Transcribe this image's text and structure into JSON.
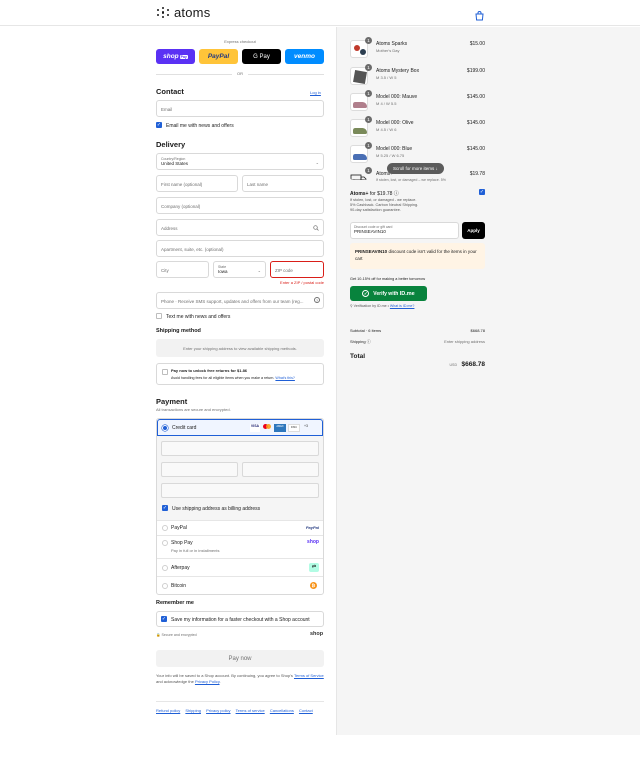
{
  "brand": {
    "name": "atoms"
  },
  "express": {
    "label": "Express checkout",
    "or": "OR",
    "shop_pay": "shop",
    "shop_pay_tag": "Pay",
    "paypal": "PayPal",
    "gpay": "G Pay",
    "venmo": "venmo",
    "colors": {
      "shop": "#5a31f4",
      "paypal": "#ffc439",
      "gpay": "#000000",
      "venmo": "#008cff"
    }
  },
  "contact": {
    "title": "Contact",
    "login": "Log in",
    "email_placeholder": "Email",
    "email_news": "Email me with news and offers"
  },
  "delivery": {
    "title": "Delivery",
    "country_label": "Country/Region",
    "country_value": "United States",
    "first_name": "First name (optional)",
    "last_name": "Last name",
    "company": "Company (optional)",
    "address": "Address",
    "apartment": "Apartment, suite, etc. (optional)",
    "city": "City",
    "state_label": "State",
    "state_value": "Iowa",
    "zip": "ZIP code",
    "zip_error": "Enter a ZIP / postal code",
    "phone": "Phone · Receive SMS support, updates and offers from our team (reg...",
    "text_news": "Text me with news and offers"
  },
  "shipping": {
    "title": "Shipping method",
    "placeholder": "Enter your shipping address to view available shipping methods.",
    "returns_title": "Pay now to unlock free returns for $1.86",
    "returns_desc": "Avoid handling fees for all eligible items when you make a return.",
    "returns_link": "What's this?"
  },
  "payment": {
    "title": "Payment",
    "subtitle": "All transactions are secure and encrypted.",
    "credit_card": "Credit card",
    "card_brands": [
      "VISA",
      "MC",
      "AMEX",
      "DISC",
      "+3"
    ],
    "billing_same": "Use shipping address as billing address",
    "paypal": "PayPal",
    "shop_pay": "Shop Pay",
    "shop_pay_sub": "Pay in full or in installments",
    "shop_logo": "shop",
    "afterpay": "Afterpay",
    "bitcoin": "Bitcoin"
  },
  "remember": {
    "title": "Remember me",
    "save_info": "Save my information for a faster checkout with a Shop account",
    "secure": "Secure and encrypted",
    "shop": "shop"
  },
  "pay_now": "Pay now",
  "legal": {
    "text1": "Your info will be saved to a Shop account. By continuing, you agree to Shop's",
    "terms": "Terms of Service",
    "and": "and acknowledge the",
    "privacy": "Privacy Policy",
    "end": "."
  },
  "footer_links": [
    "Refund policy",
    "Shipping",
    "Privacy policy",
    "Terms of service",
    "Cancellations",
    "Contact"
  ],
  "cart": {
    "items": [
      {
        "qty": "1",
        "name": "Atoms Sparks",
        "variant": "Mother's Day",
        "price": "$15.00"
      },
      {
        "qty": "1",
        "name": "Atoms Mystery Box",
        "variant": "M 3.5 / W 5",
        "price": "$199.00"
      },
      {
        "qty": "1",
        "name": "Model 000: Mauve",
        "variant": "M 4 / W 5.5",
        "price": "$145.00"
      },
      {
        "qty": "1",
        "name": "Model 000: Olive",
        "variant": "M 4.5 / W 6",
        "price": "$145.00"
      },
      {
        "qty": "1",
        "name": "Model 000: Blue",
        "variant": "M 5.25 / W 6.75",
        "price": "$145.00"
      },
      {
        "qty": "1",
        "name": "Atoms+",
        "variant": "If stolen, lost, or damaged – we replace. 5%",
        "price": "$19.78"
      }
    ],
    "scroll_tip": "Scroll for more items",
    "atoms_plus": {
      "title": "Atoms+",
      "for": "for $19.78",
      "lines": [
        "If stolen, lost, or damaged - we replace.",
        "5% Cashback. Carbon Neutral Shipping.",
        "90-day satisfaction guarantee."
      ]
    },
    "discount": {
      "label": "Discount code or gift card",
      "value": "PRINSEAVIN10",
      "apply": "Apply",
      "error_code": "PRINSEAVIN10",
      "error_text": "discount code isn't valid for the items in your cart"
    },
    "idme": {
      "offer": "Get 10-15% off for making a better tomorrow",
      "button": "Verify with",
      "brand": "ID.me",
      "note": "Verification by ID.me •",
      "link": "What is ID.me?"
    },
    "subtotal_label": "Subtotal · 6 items",
    "subtotal": "$668.78",
    "shipping_label": "Shipping",
    "shipping_value": "Enter shipping address",
    "total_label": "Total",
    "currency": "USD",
    "total": "$668.78"
  }
}
